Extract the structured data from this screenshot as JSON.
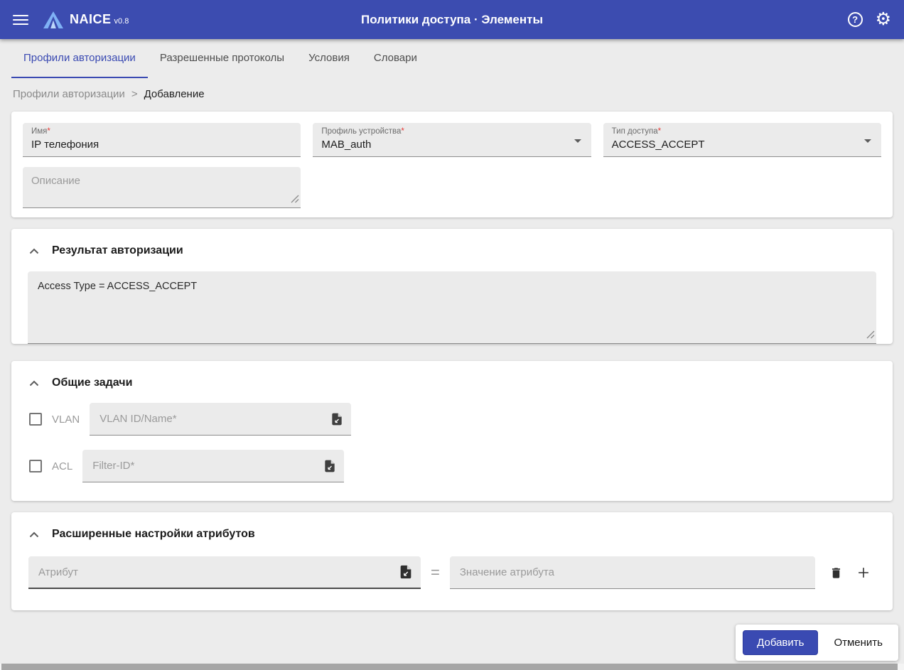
{
  "appbar": {
    "app_name": "NAICE",
    "app_version": "v0.8",
    "title": "Политики доступа · Элементы"
  },
  "icons": {
    "help_glyph": "?",
    "settings_glyph": "⚙"
  },
  "tabs": [
    {
      "label": "Профили авторизации",
      "active": true
    },
    {
      "label": "Разрешенные протоколы",
      "active": false
    },
    {
      "label": "Условия",
      "active": false
    },
    {
      "label": "Словари",
      "active": false
    }
  ],
  "breadcrumb": {
    "root": "Профили авторизации",
    "separator": ">",
    "current": "Добавление"
  },
  "general": {
    "name": {
      "label": "Имя",
      "required_mark": "*",
      "value": "IP телефония"
    },
    "device_profile": {
      "label": "Профиль устройства",
      "required_mark": "*",
      "value": "MAB_auth"
    },
    "access_type": {
      "label": "Тип доступа",
      "required_mark": "*",
      "value": "ACCESS_ACCEPT"
    },
    "description_placeholder": "Описание"
  },
  "sections": {
    "authorization_result": {
      "title": "Результат авторизации",
      "content": "Access Type = ACCESS_ACCEPT"
    },
    "common_tasks": {
      "title": "Общие задачи",
      "rows": [
        {
          "label": "VLAN",
          "placeholder": "VLAN ID/Name*",
          "checked": false
        },
        {
          "label": "ACL",
          "placeholder": "Filter-ID*",
          "checked": false
        }
      ]
    },
    "advanced": {
      "title": "Расширенные настройки атрибутов",
      "attribute_placeholder": "Атрибут",
      "equals_sign": "=",
      "value_placeholder": "Значение атрибута"
    }
  },
  "actions": {
    "submit_label": "Добавить",
    "cancel_label": "Отменить"
  },
  "colors": {
    "primary": "#3c4cb0",
    "button": "#3a4ab2",
    "required": "#e53935"
  }
}
